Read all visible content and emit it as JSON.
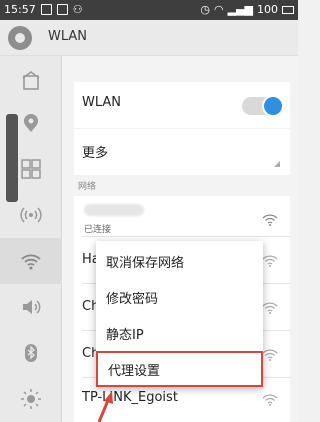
{
  "status_bar": {
    "time": "15:57",
    "battery": "100"
  },
  "app_bar": {
    "title": "WLAN"
  },
  "wlan_row": {
    "label": "WLAN",
    "enabled": true
  },
  "more_row": {
    "label": "更多"
  },
  "networks_section": {
    "label": "网络"
  },
  "networks": [
    {
      "name": "",
      "status": "已连接"
    },
    {
      "name": "Ha"
    },
    {
      "name": "Ch"
    },
    {
      "name": "Ch"
    },
    {
      "name": "TP-LINK_Egoist"
    }
  ],
  "context_menu": {
    "items": [
      "取消保存网络",
      "修改密码",
      "静态IP",
      "代理设置"
    ],
    "highlighted": "代理设置"
  },
  "colors": {
    "accent": "#2f8fe0",
    "highlight_border": "#d9463e"
  }
}
